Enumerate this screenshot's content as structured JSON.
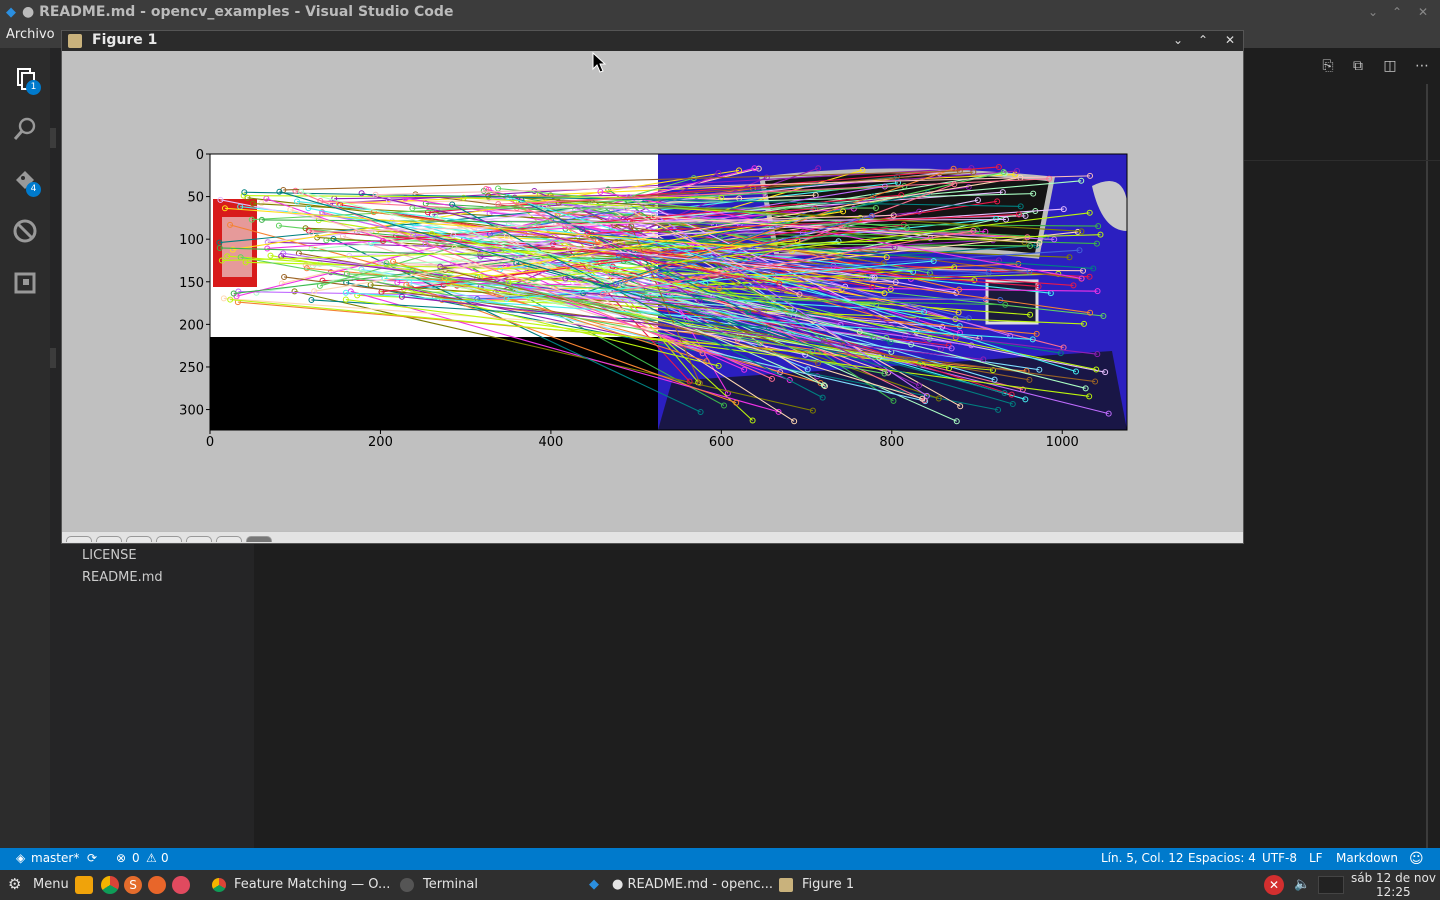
{
  "vscode": {
    "title": "● README.md - opencv_examples - Visual Studio Code",
    "menu": [
      "Archivo"
    ],
    "activity_badges": {
      "explorer": "1",
      "scm": "4"
    },
    "sidebar_files": [
      "LICENSE",
      "README.md"
    ]
  },
  "figure": {
    "title": "Figure 1",
    "chart_data": {
      "type": "image",
      "x_ticks": [
        "0",
        "200",
        "400",
        "600",
        "800",
        "1000"
      ],
      "y_ticks": [
        "0",
        "50",
        "100",
        "150",
        "200",
        "250",
        "300"
      ],
      "xlim": [
        0,
        1076
      ],
      "ylim": [
        324,
        0
      ],
      "tick_x_values": [
        0,
        200,
        400,
        600,
        800,
        1000
      ],
      "tick_y_values": [
        0,
        50,
        100,
        150,
        200,
        250,
        300
      ],
      "left_image_width": 526,
      "left_template_height": 215
    }
  },
  "statusbar": {
    "branch": "master*",
    "errors": "0",
    "warnings": "0",
    "position": "Lín. 5, Col. 12",
    "spaces": "Espacios: 4",
    "encoding": "UTF-8",
    "eol": "LF",
    "language": "Markdown"
  },
  "taskbar": {
    "menu": "Menu",
    "tasks": [
      "Feature Matching — O...",
      "Terminal",
      "● README.md - openc...",
      "Figure 1"
    ],
    "date": "sáb 12 de nov",
    "time": "12:25"
  },
  "colors": {
    "statusbar": "#007acc",
    "plot_bg": "#c0c0c0",
    "car_blue": "#2b1fc0",
    "plate_red": "#d81b1b"
  }
}
